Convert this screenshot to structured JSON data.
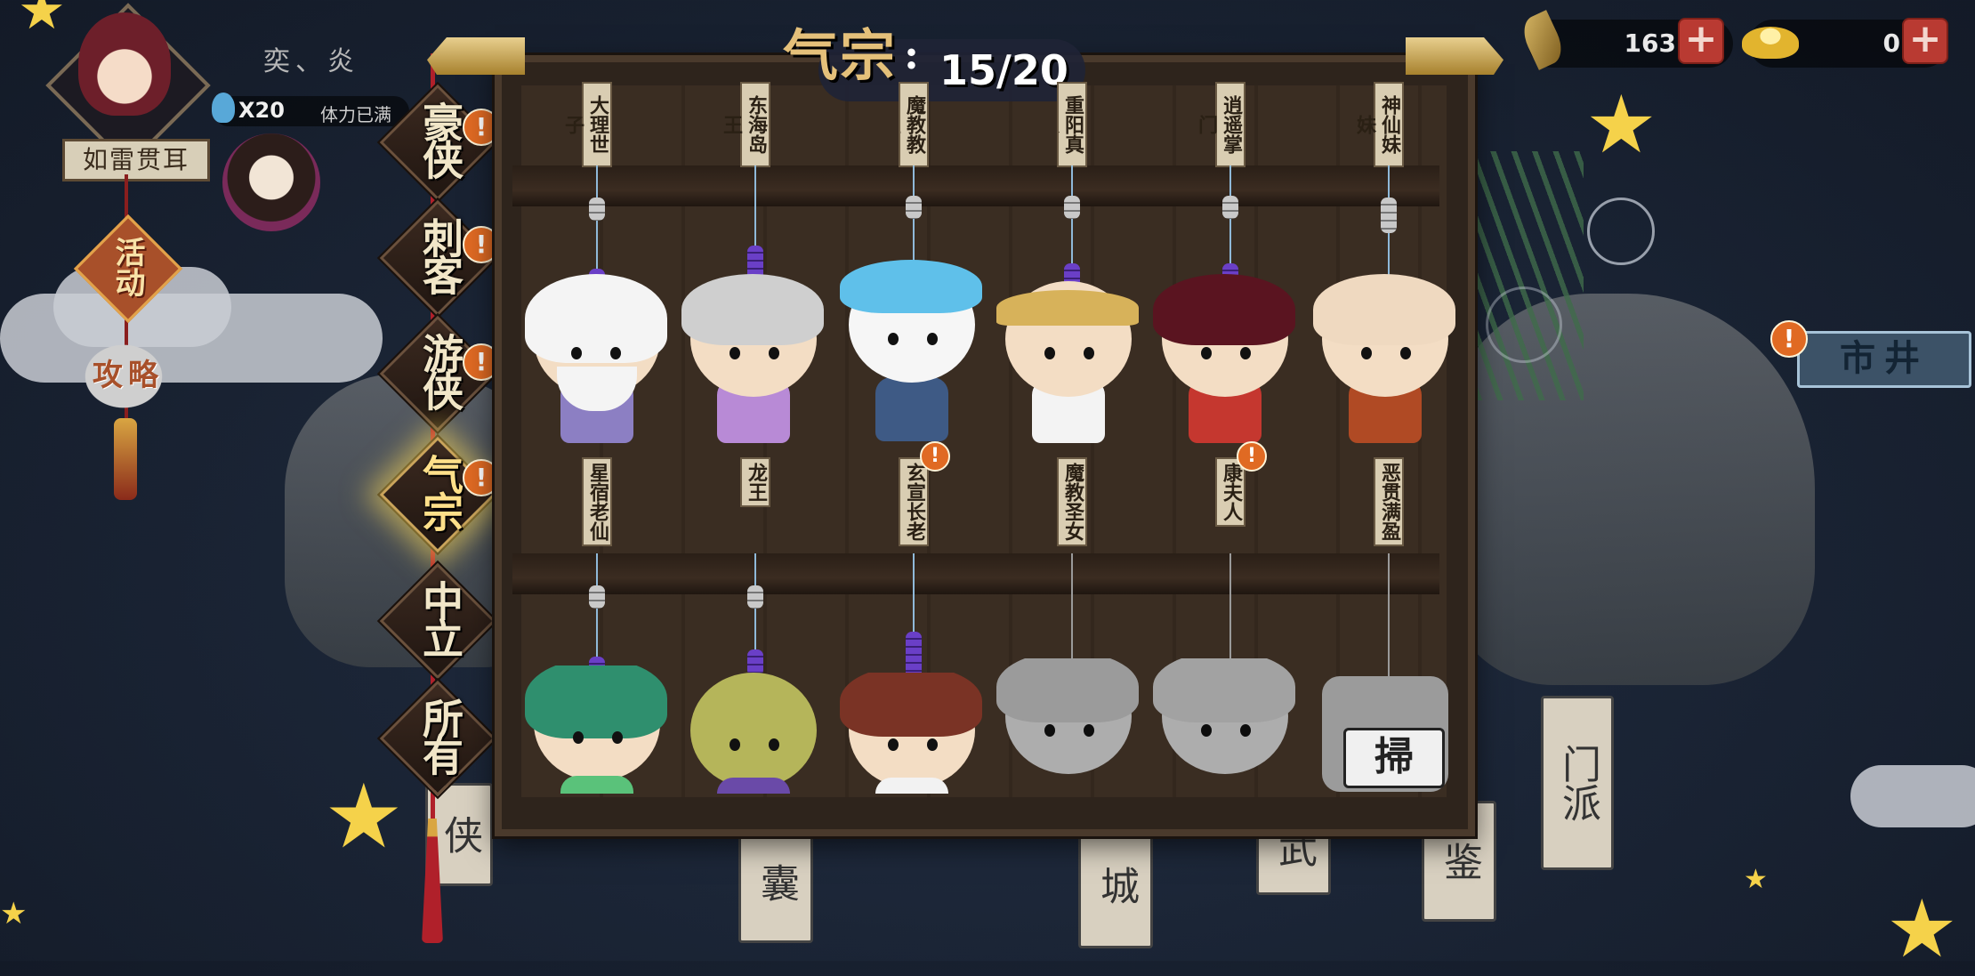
{
  "player": {
    "name": "奕、炎",
    "stamina_count": "X20",
    "stamina_status": "体力已满",
    "title_plaque": "如雷贯耳"
  },
  "left_menu": {
    "event_label": "活动",
    "guide_label": "攻略"
  },
  "resources": {
    "leaf_count": "163",
    "gold_count": "0"
  },
  "header": {
    "category_title": "气宗",
    "separator": ":",
    "progress": "15/20",
    "collected": 15,
    "total": 20
  },
  "categories": [
    {
      "label": "豪侠",
      "alert": true,
      "active": false
    },
    {
      "label": "刺客",
      "alert": true,
      "active": false
    },
    {
      "label": "游侠",
      "alert": true,
      "active": false
    },
    {
      "label": "气宗",
      "alert": true,
      "active": true
    },
    {
      "label": "中立",
      "alert": false,
      "active": false
    },
    {
      "label": "所有",
      "alert": false,
      "active": false
    }
  ],
  "row1_tags": [
    "大理世子",
    "东海岛王",
    "魔教教主",
    "重阳真人",
    "逍遥掌门",
    "神仙妹妹"
  ],
  "row2_tags": [
    "星宿老仙",
    "龙王",
    "玄宣长老",
    "魔教圣女",
    "康夫人",
    "恶贯满盈"
  ],
  "row2_alerts": [
    false,
    false,
    true,
    false,
    true,
    false
  ],
  "row3_locked": [
    false,
    false,
    false,
    true,
    true,
    true
  ],
  "lock_label": "掃",
  "right_button": "市井",
  "bottom_plaques": [
    "门派",
    "侠",
    "囊",
    "城",
    "武",
    "鉴"
  ],
  "alert_symbol": "!",
  "colors": {
    "accent_gold": "#caa45a",
    "alert_orange": "#e06a23",
    "plus_red": "#b93a32",
    "bead_purple": "#6a3fc7"
  },
  "icons": {
    "leaf": "leaf-icon",
    "gold": "gold-ingot-icon",
    "potion": "potion-icon",
    "plus": "plus-icon"
  }
}
